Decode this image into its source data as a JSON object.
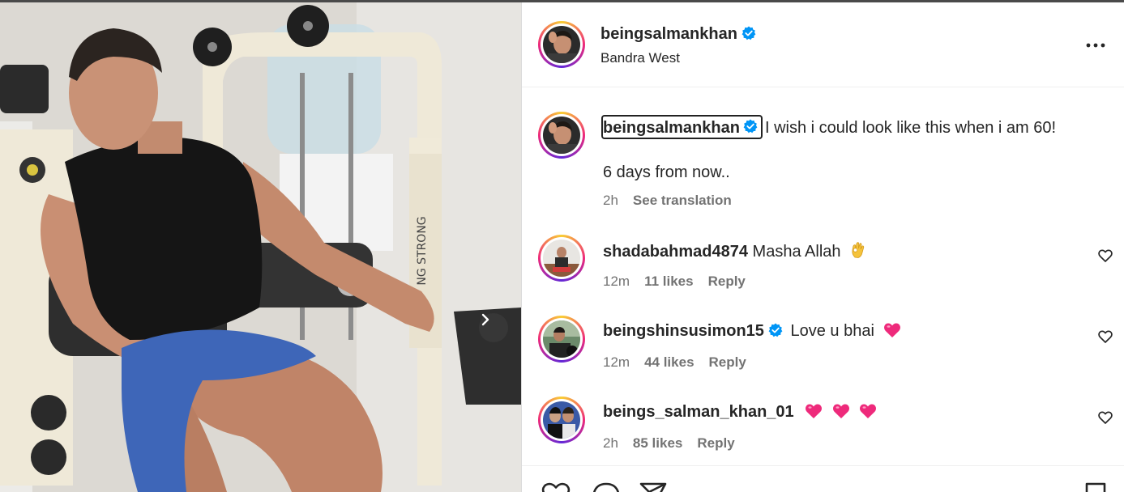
{
  "post": {
    "author": "beingsalmankhan",
    "location": "Bandra West",
    "caption_line1": "I wish i could look like this when i am 60!",
    "caption_line2": "6 days from now..",
    "time": "2h",
    "see_translation": "See translation"
  },
  "comments": [
    {
      "user": "shadabahmad4874",
      "text": "Masha Allah",
      "emoji": "ok-hand",
      "verified": false,
      "time": "12m",
      "likes": "11 likes",
      "reply": "Reply"
    },
    {
      "user": "beingshinsusimon15",
      "text": "Love u bhai",
      "emoji": "pink-heart",
      "verified": true,
      "time": "12m",
      "likes": "44 likes",
      "reply": "Reply"
    },
    {
      "user": "beings_salman_khan_01",
      "text": "",
      "emoji": "pink-heart x3",
      "verified": false,
      "time": "2h",
      "likes": "85 likes",
      "reply": "Reply"
    }
  ],
  "colors": {
    "verified": "#0095f6",
    "muted": "#737373",
    "heart": "#ee2a7b",
    "text": "#262626"
  },
  "icons": [
    "verified-badge-icon",
    "more-options-icon",
    "heart-outline-icon",
    "chevron-right-icon",
    "comment-icon",
    "share-icon",
    "bookmark-icon"
  ]
}
